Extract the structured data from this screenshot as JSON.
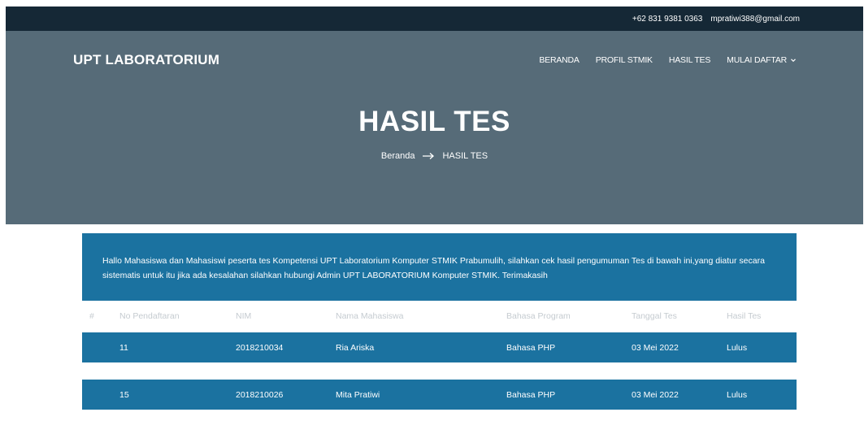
{
  "topbar": {
    "phone": "+62 831 9381 0363",
    "email": "mpratiwi388@gmail.com"
  },
  "header": {
    "brand": "UPT LABORATORIUM",
    "nav": [
      {
        "label": "BERANDA"
      },
      {
        "label": "PROFIL STMIK"
      },
      {
        "label": "HASIL TES"
      },
      {
        "label": "MULAI DAFTAR"
      }
    ]
  },
  "hero": {
    "title": "HASIL TES",
    "breadcrumb": {
      "home": "Beranda",
      "current": "HASIL TES"
    }
  },
  "notice": {
    "text": "Hallo Mahasiswa dan Mahasiswi peserta tes Kompetensi UPT Laboratorium Komputer STMIK Prabumulih, silahkan cek hasil pengumuman Tes di bawah ini,yang diatur secara sistematis untuk itu jika ada kesalahan silahkan hubungi Admin UPT LABORATORIUM Komputer STMIK. Terimakasih"
  },
  "table": {
    "columns": [
      "#",
      "No Pendaftaran",
      "NIM",
      "Nama Mahasiswa",
      "Bahasa Program",
      "Tanggal Tes",
      "Hasil Tes"
    ],
    "rows": [
      {
        "no": "11",
        "nim": "2018210034",
        "nama": "Ria Ariska",
        "bahasa": "Bahasa PHP",
        "tanggal": "03 Mei 2022",
        "hasil": "Lulus"
      },
      {
        "no": "15",
        "nim": "2018210026",
        "nama": "Mita Pratiwi",
        "bahasa": "Bahasa PHP",
        "tanggal": "03 Mei 2022",
        "hasil": "Lulus"
      }
    ]
  },
  "colors": {
    "topbar": "#152836",
    "hero": "#566b78",
    "accent": "#1b72a0"
  },
  "icons": {
    "breadcrumb_separator": "arrow-right-icon",
    "dropdown": "chevron-down-icon"
  }
}
